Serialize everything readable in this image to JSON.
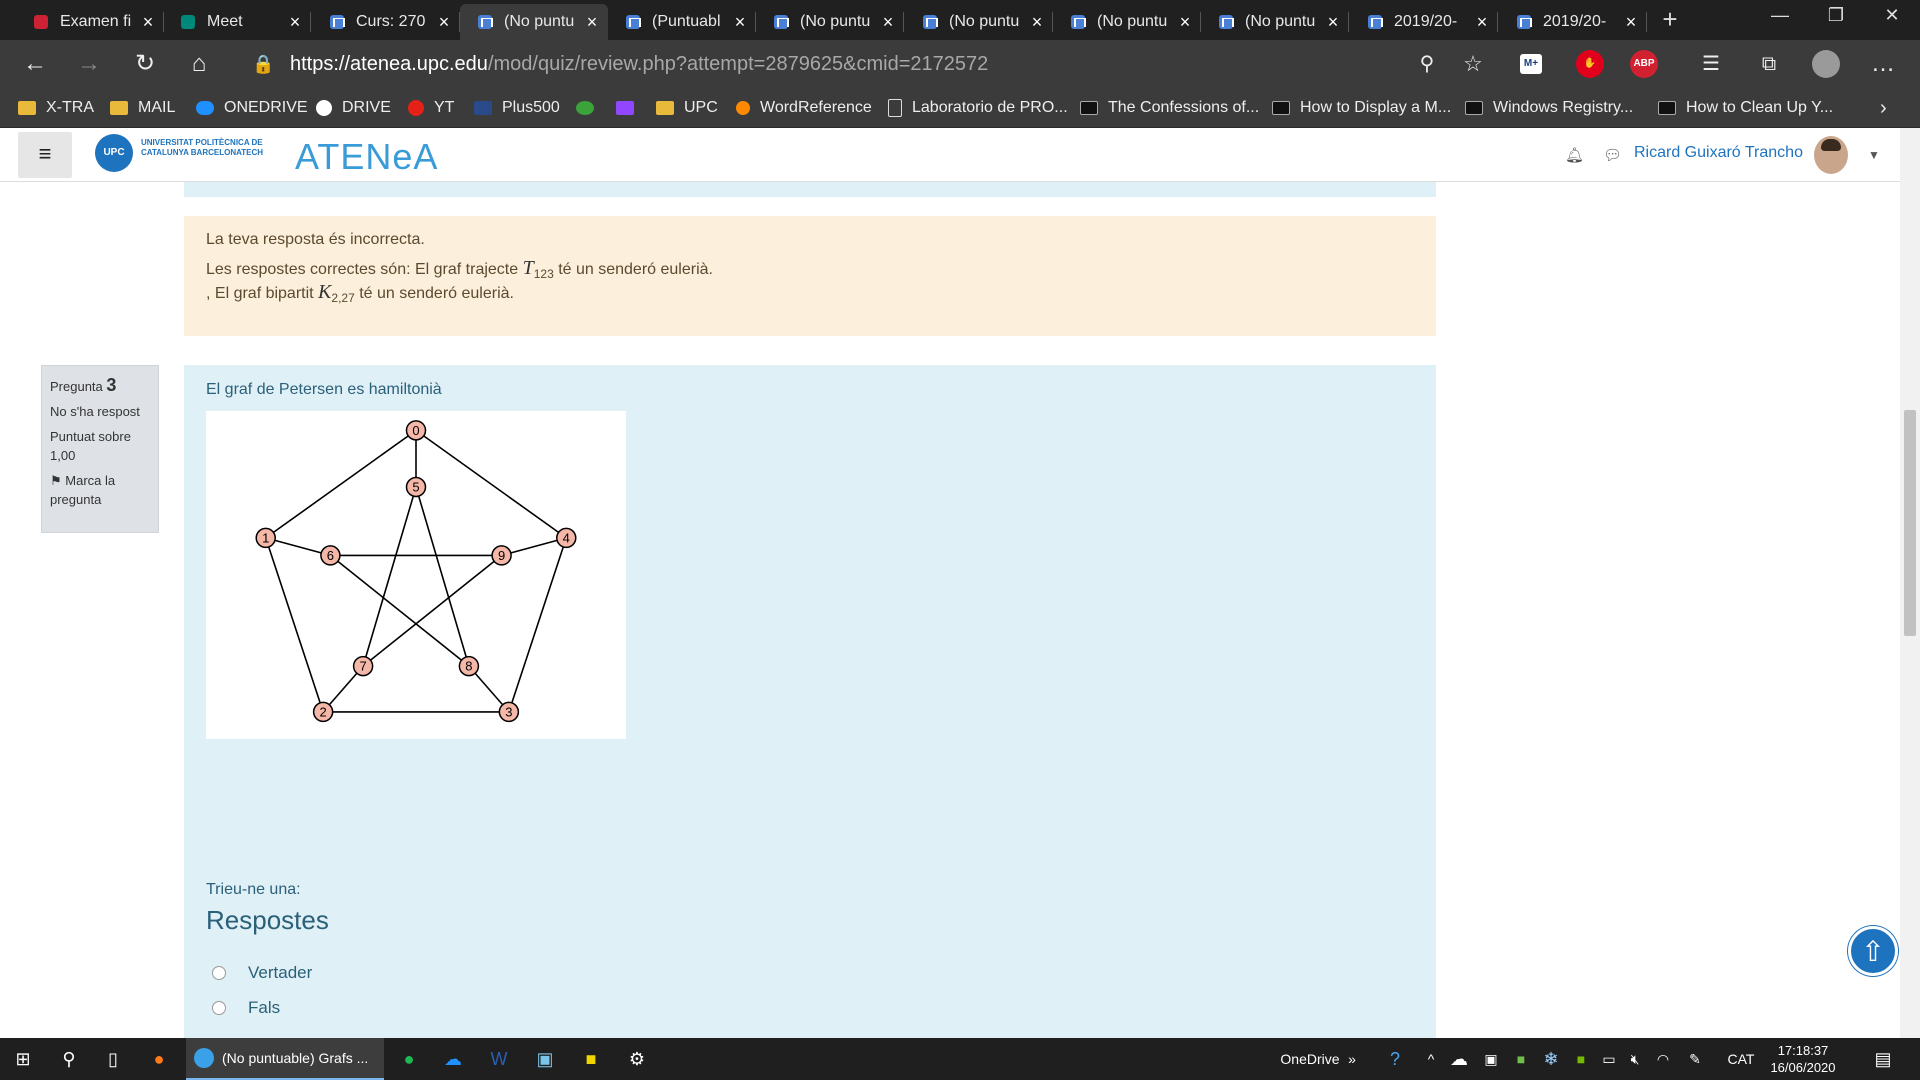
{
  "browser": {
    "tabs": [
      {
        "title": "Examen fi",
        "active": false
      },
      {
        "title": "Meet",
        "active": false
      },
      {
        "title": "Curs: 270",
        "active": false
      },
      {
        "title": "(No puntu",
        "active": true
      },
      {
        "title": "(Puntuabl",
        "active": false
      },
      {
        "title": "(No puntu",
        "active": false
      },
      {
        "title": "(No puntu",
        "active": false
      },
      {
        "title": "(No puntu",
        "active": false
      },
      {
        "title": "(No puntu",
        "active": false
      },
      {
        "title": "2019/20-",
        "active": false
      },
      {
        "title": "2019/20-",
        "active": false
      }
    ],
    "url_host": "https://atenea.upc.edu",
    "url_path": "/mod/quiz/review.php?attempt=2879625&cmid=2172572",
    "extensions": [
      "M+",
      "ABP"
    ],
    "bookmarks": [
      "X-TRA",
      "MAIL",
      "ONEDRIVE",
      "DRIVE",
      "YT",
      "Plus500",
      "UPC",
      "WordReference",
      "Laboratorio de PRO...",
      "The Confessions of...",
      "How to Display a M...",
      "Windows Registry...",
      "How to Clean Up Y..."
    ]
  },
  "site": {
    "logo_text": "UNIVERSITAT POLITÈCNICA DE CATALUNYA BARCELONATECH",
    "logo_mark": "UPC",
    "brand": "ATENeA",
    "user_name": "Ricard Guixaró Trancho"
  },
  "feedback": {
    "line1": "La teva resposta és incorrecta.",
    "line2_pre": "Les respostes correctes són: El graf trajecte ",
    "line2_math": "T",
    "line2_sub": "123",
    "line2_post": " té un senderó eulerià.",
    "line3_pre": ", El graf bipartit ",
    "line3_math": "K",
    "line3_sub": "2,27",
    "line3_post": " té un senderó eulerià."
  },
  "question": {
    "label": "Pregunta",
    "number": "3",
    "status": "No s'ha respost",
    "grade": "Puntuat sobre 1,00",
    "flag": "Marca la pregunta",
    "text": "El graf de Petersen es hamiltonià",
    "choose": "Trieu-ne una:",
    "answers_heading": "Respostes",
    "options": [
      "Vertader",
      "Fals"
    ]
  },
  "graph": {
    "nodes": [
      "0",
      "1",
      "2",
      "3",
      "4",
      "5",
      "6",
      "7",
      "8",
      "9"
    ],
    "edges": [
      [
        "0",
        "1"
      ],
      [
        "0",
        "4"
      ],
      [
        "0",
        "5"
      ],
      [
        "1",
        "2"
      ],
      [
        "1",
        "6"
      ],
      [
        "2",
        "3"
      ],
      [
        "2",
        "7"
      ],
      [
        "3",
        "4"
      ],
      [
        "3",
        "8"
      ],
      [
        "4",
        "9"
      ],
      [
        "5",
        "7"
      ],
      [
        "5",
        "8"
      ],
      [
        "6",
        "8"
      ],
      [
        "6",
        "9"
      ],
      [
        "7",
        "9"
      ]
    ],
    "node_fill": "#f5b8a8",
    "edge_color": "#000000"
  },
  "taskbar": {
    "active_app": "(No puntuable) Grafs ...",
    "onedrive": "OneDrive",
    "lang": "CAT",
    "time": "17:18:37",
    "date": "16/06/2020"
  }
}
